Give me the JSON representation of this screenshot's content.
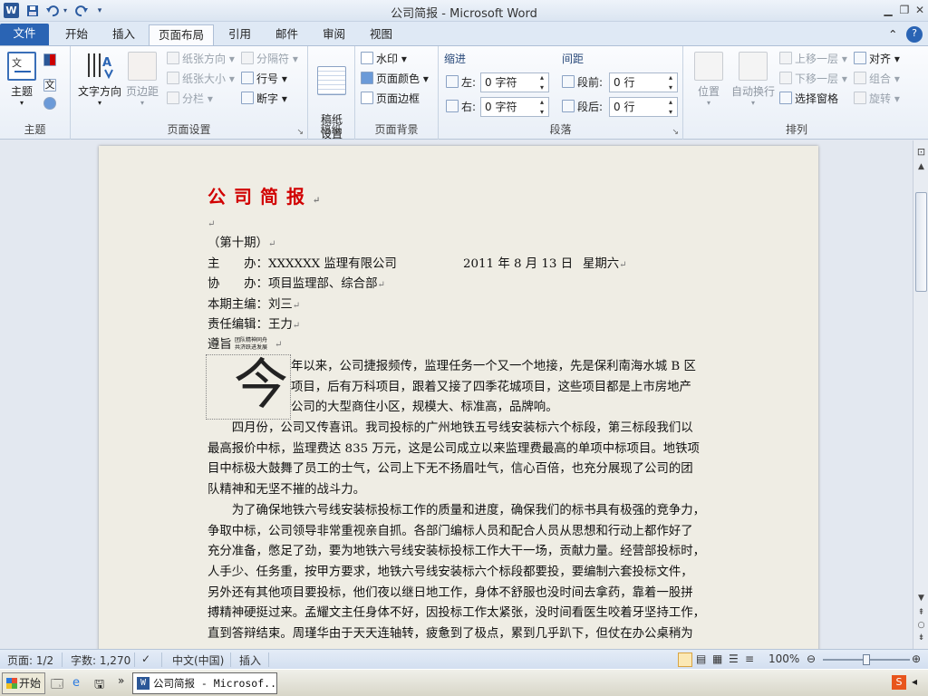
{
  "window": {
    "title": "公司简报 - Microsoft Word",
    "app_logo": "W"
  },
  "quick_access": {
    "save": "save-icon",
    "undo": "undo-icon",
    "redo": "redo-icon",
    "customize": "▾"
  },
  "tabs": [
    {
      "label": "文件"
    },
    {
      "label": "开始"
    },
    {
      "label": "插入"
    },
    {
      "label": "页面布局"
    },
    {
      "label": "引用"
    },
    {
      "label": "邮件"
    },
    {
      "label": "审阅"
    },
    {
      "label": "视图"
    }
  ],
  "ribbon": {
    "theme": {
      "group": "主题",
      "btn": "主题"
    },
    "page_setup": {
      "group": "页面设置",
      "text_direction": "文字方向",
      "margins": "页边距",
      "orientation": "纸张方向",
      "size": "纸张大小",
      "columns": "分栏",
      "breaks": "分隔符",
      "line_numbers": "行号",
      "hyphenation": "断字"
    },
    "draft": {
      "group": "稿纸",
      "btn": "稿纸\n设置"
    },
    "background": {
      "group": "页面背景",
      "watermark": "水印",
      "page_color": "页面颜色",
      "page_border": "页面边框"
    },
    "paragraph": {
      "group": "段落",
      "indent_title": "缩进",
      "spacing_title": "间距",
      "left_label": "左:",
      "right_label": "右:",
      "before_label": "段前:",
      "after_label": "段后:",
      "left_val": "0 字符",
      "right_val": "0 字符",
      "before_val": "0 行",
      "after_val": "0 行"
    },
    "arrange": {
      "group": "排列",
      "position": "位置",
      "wrap": "自动换行",
      "bring_forward": "上移一层",
      "send_backward": "下移一层",
      "selection_pane": "选择窗格",
      "align": "对齐",
      "group_btn": "组合",
      "rotate": "旋转"
    }
  },
  "document": {
    "heading": "公司简报",
    "issue": "（第十期）",
    "host_label": "主　　办：",
    "host": "XXXXXX 监理有限公司",
    "date": "2011 年 8 月 13 日",
    "weekday": "星期六",
    "co_label": "协　　办：",
    "co": "项目监理部、综合部",
    "editor_label": "本期主编：",
    "editor": "刘三",
    "duty_label": "责任编辑：",
    "duty": "王力",
    "purpose_label": "遵旨",
    "purpose_small1": "团队精神同舟",
    "purpose_small2": "共济跃进发展",
    "dropcap": "今",
    "lines": [
      "年以来，公司捷报频传，监理任务一个又一个地接，先是保利南海水城 B 区",
      "项目，后有万科项目，跟着又接了四季花城项目，这些项目都是上市房地产",
      "公司的大型商住小区，规模大、标准高，品牌响。",
      "　　四月份，公司又传喜讯。我司投标的广州地铁五号线安装标六个标段，第三标段我们以",
      "最高报价中标，监理费达 835 万元，这是公司成立以来监理费最高的单项中标项目。地铁项",
      "目中标极大鼓舞了员工的士气，公司上下无不扬眉吐气，信心百倍，也充分展现了公司的团",
      "队精神和无坚不摧的战斗力。",
      "　　为了确保地铁六号线安装标投标工作的质量和进度，确保我们的标书具有极强的竞争力，",
      "争取中标，公司领导非常重视亲自抓。各部门编标人员和配合人员从思想和行动上都作好了",
      "充分准备，憋足了劲，要为地铁六号线安装标投标工作大干一场，贡献力量。经营部投标时，",
      "人手少、任务重，按甲方要求，地铁六号线安装标六个标段都要投，要编制六套投标文件，",
      "另外还有其他项目要投标，他们夜以继日地工作，身体不舒服也没时间去拿药，靠着一股拼",
      "搏精神硬挺过来。孟耀文主任身体不好，因投标工作太紧张，没时间看医生咬着牙坚持工作，",
      "直到答辩结束。周瑾华由于天天连轴转，疲惫到了极点，累到几乎趴下，但仗在办公桌稍为"
    ]
  },
  "statusbar": {
    "page": "页面: 1/2",
    "words": "字数: 1,270",
    "lang": "中文(中国)",
    "mode": "插入",
    "zoom": "100%",
    "zoom_level": 1.0
  },
  "taskbar": {
    "start": "开始",
    "item": "公司简报 - Microsof..."
  }
}
